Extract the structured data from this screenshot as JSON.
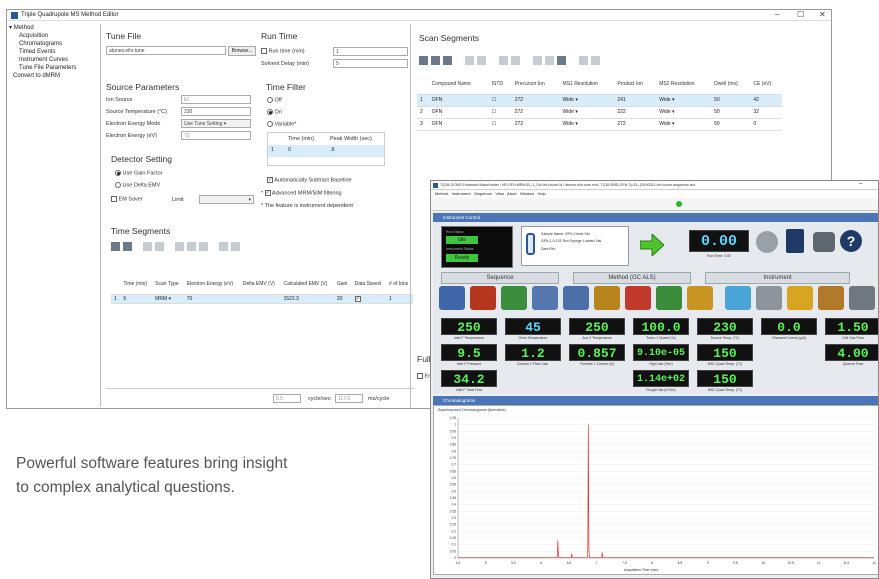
{
  "main_window": {
    "title": "Triple Quadrupole MS Method Editor",
    "controls": [
      "–",
      "☐",
      "✕"
    ],
    "tree": [
      "Method",
      "Acquisition",
      "Chromatograms",
      "Timed Events",
      "Instrument Curves",
      "Tune File Parameters",
      "Convert to dMRM"
    ],
    "tune_file": {
      "heading": "Tune File",
      "value": "atunes.eihr.tune",
      "browse": "Browse..."
    },
    "run_time": {
      "heading": "Run Time",
      "run_time_label": "Run time (min)",
      "run_time_value": "1",
      "solvent_delay_label": "Solvent Delay (min)",
      "solvent_delay_value": "5"
    },
    "source": {
      "heading": "Source Parameters",
      "ion_source_label": "Ion Source",
      "ion_source_value": "EI",
      "temp_label": "Source Temperature (°C)",
      "temp_value": "230",
      "ee_mode_label": "Electron Energy Mode",
      "ee_mode_value": "Use Tune Setting",
      "ee_label": "Electron Energy (eV)",
      "ee_value": "70"
    },
    "time_filter": {
      "heading": "Time Filter",
      "opt_off": "Off",
      "opt_on": "On",
      "opt_variable": "Variable*",
      "col_time": "Time (min)",
      "col_peak": "Peak Width (sec)",
      "row_n": "1",
      "row_time": "0",
      "row_peak": ".8",
      "auto_baseline": "Automatically Subtract Baseline",
      "adv_filter": "Advanced MRM/SIM filtering",
      "note": "* The feature is instrument dependent"
    },
    "detector": {
      "heading": "Detector Setting",
      "gain": "Use Gain Factor",
      "delta": "Use Delta EMV",
      "em_saver": "EM Saver",
      "limit": "Limit"
    },
    "time_segments": {
      "heading": "Time Segments",
      "cols": [
        "Time (min)",
        "Scan Type",
        "Electron Energy (eV)",
        "Delta EMV (V)",
        "Calculated EMV (V)",
        "Gain",
        "Data Saved",
        "# of Ions"
      ],
      "row": [
        "1",
        "5",
        "MRM",
        "70",
        "",
        "1522.3",
        "20",
        "",
        "1"
      ]
    },
    "scan_segments": {
      "heading": "Scan Segments",
      "cols": [
        "Compound Name",
        "ISTD",
        "Precursor Ion",
        "MS1 Resolution",
        "Product Ion",
        "MS2 Resolution",
        "Dwell (ms)",
        "CE (eV)"
      ],
      "rows": [
        [
          "1",
          "OFN",
          "272",
          "Wide",
          "241",
          "Wide",
          "50",
          "42"
        ],
        [
          "2",
          "OFN",
          "272",
          "Wide",
          "222",
          "Wide",
          "50",
          "32"
        ],
        [
          "3",
          "OFN",
          "272",
          "Wide",
          "272",
          "Wide",
          "50",
          "0"
        ]
      ]
    },
    "bottom": {
      "full_label": "Full",
      "enable": "Ena",
      "cycles_value": "8.5",
      "cycles_label": "cycle/sec",
      "ms_value": "117.6",
      "ms_label": "ms/cycle"
    }
  },
  "caption": [
    "Powerful software features bring insight",
    "to complex analytical questions."
  ],
  "instrument_window": {
    "title": "TQ1B-GCMS Enhanced MassHunter / HP-OFN-MRM-EL-1_Sol-He-Iocom.M / atunes.eihr.tune.xml / TQ1B-RBD-OFN-Tp-DL-20190311-He-Iocom.sequence.xml",
    "menu": [
      "Method",
      "Instrument",
      "Sequence",
      "View",
      "Abort",
      "Window",
      "Help"
    ],
    "panel_title": "Instrument Control",
    "run_status_label": "Run Status",
    "run_status": "Idle",
    "inst_status_label": "Instrument Status",
    "inst_status": "Ready",
    "sample_name": "Sample Name: OFN Check Std",
    "data_file": "Data File:",
    "misc": "OFN-1-9-101 Run Syringe Loaded Vial",
    "run_time_value": "0.00",
    "run_time_label": "Run Time: 0.00",
    "tabs": [
      "Sequence",
      "Method (GC ALS)",
      "Instrument"
    ],
    "readouts": [
      {
        "v": "250",
        "l": "Inlet F Temperature",
        "c": "#5af25a"
      },
      {
        "v": "45",
        "l": "Oven Temperature",
        "c": "#5cd6ff"
      },
      {
        "v": "250",
        "l": "Aux 2 Temperature",
        "c": "#5af25a"
      },
      {
        "v": "100.0",
        "l": "Turbo 1 Speed (%)",
        "c": "#5af25a"
      },
      {
        "v": "230",
        "l": "Source Temp. (°C)",
        "c": "#5af25a"
      },
      {
        "v": "0.0",
        "l": "Filament Current (µA)",
        "c": "#5af25a"
      },
      {
        "v": "1.50",
        "l": "Cell Gas Flow",
        "c": "#5af25a"
      },
      {
        "v": "9.5",
        "l": "Inlet F Pressure",
        "c": "#5af25a"
      },
      {
        "v": "1.2",
        "l": "Column 1 Flow Calc.",
        "c": "#5af25a"
      },
      {
        "v": "0.857",
        "l": "Foreline 1 Current (A)",
        "c": "#5af25a"
      },
      {
        "v": "9.10e-05",
        "l": "High Vac (Torr)",
        "c": "#5af25a"
      },
      {
        "v": "150",
        "l": "MS1 Quad Temp. (°C)",
        "c": "#5af25a"
      },
      {
        "v": "4.00",
        "l": "Quench Flow",
        "c": "#5af25a"
      },
      {
        "v": "34.2",
        "l": "Inlet F Total Flow",
        "c": "#5af25a"
      },
      {
        "v": "1.14e+02",
        "l": "Rough Vac (mTorr)",
        "c": "#5af25a"
      },
      {
        "v": "150",
        "l": "MS2 Quad Temp. (°C)",
        "c": "#5af25a"
      }
    ],
    "chrom_title": "Chromatograms",
    "chrom_subtitle": "Superimposed Chromatograms (Normalize)",
    "x_ticks": [
      "4.5",
      "5",
      "5.5",
      "6",
      "6.5",
      "7",
      "7.5",
      "8",
      "8.5",
      "9",
      "9.5",
      "10",
      "10.5",
      "11",
      "11.5",
      "12"
    ],
    "y_ticks": [
      "1.05",
      "1",
      "0.95",
      "0.9",
      "0.85",
      "0.8",
      "0.75",
      "0.7",
      "0.65",
      "0.6",
      "0.55",
      "0.5",
      "0.45",
      "0.4",
      "0.35",
      "0.3",
      "0.25",
      "0.2",
      "0.15",
      "0.1",
      "0.05",
      "0"
    ],
    "x_label": "Acquisition Time (min)"
  }
}
